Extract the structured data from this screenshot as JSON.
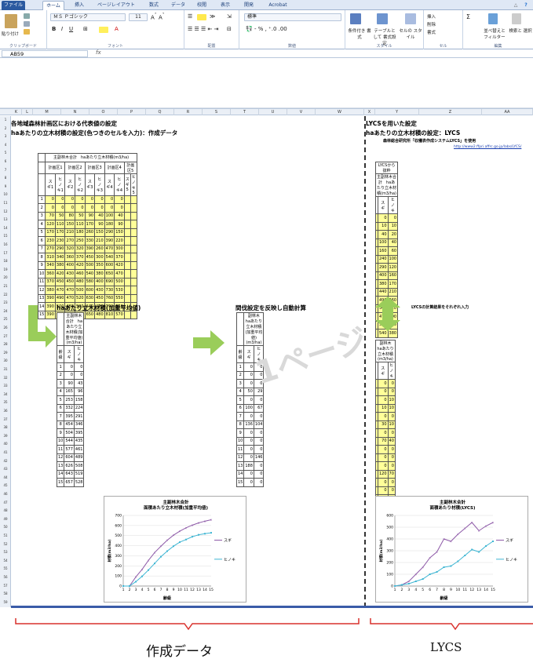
{
  "menubar": {
    "tabs": [
      "ファイル",
      "ホーム",
      "挿入",
      "ページレイアウト",
      "数式",
      "データ",
      "校閲",
      "表示",
      "開発",
      "Acrobat"
    ]
  },
  "ribbon": {
    "paste": "貼り付け",
    "clipboard": "クリップボード",
    "font_name": "ＭＳ Ｐゴシック",
    "font_size": "11",
    "font_group": "フォント",
    "align_group": "配置",
    "number_format": "標準",
    "number_group": "数値",
    "cond_format": "条件付き 書式",
    "table_format": "テーブルとして 書式設定",
    "cell_style": "セルの スタイル",
    "style_group": "スタイル",
    "insert": "挿入",
    "delete": "削除",
    "format": "書式",
    "cell_group": "セル",
    "sort": "並べ替えと フィルター",
    "find": "検索と 選択",
    "edit_group": "編集"
  },
  "formula": {
    "namebox": "AB59",
    "fx": "fx"
  },
  "columns": [
    "K",
    "L",
    "M",
    "N",
    "O",
    "P",
    "Q",
    "R",
    "S",
    "T",
    "U",
    "V",
    "W",
    "X",
    "Y",
    "Z",
    "AA"
  ],
  "titles": {
    "left1": "各地域森林計画区における代表値の設定",
    "left2": "haあたりの立木材積の設定(色つきのセルを入力)：作成データ",
    "right1": "LYCSを用いた設定",
    "right2": "haあたりの立木材積の設定：LYCS",
    "right3": "森林総合研究所「収穫表作成システムLYCS」を使用",
    "right_url": "http://www2.ffpri.affrc.go.jp/labs/LYCS/"
  },
  "table1": {
    "title": "主副林木合計　haあたり立木材積(m3/ha)",
    "groups": [
      "計画区1",
      "計画区2",
      "計画区3",
      "計画区4",
      "計画区5"
    ],
    "sub": [
      "スギ1",
      "ヒノキ1",
      "スギ2",
      "ヒノキ2",
      "スギ3",
      "ヒノキ3",
      "スギ4",
      "ヒノキ4",
      "スギ5",
      "ヒノキ5"
    ],
    "rows": [
      [
        "1",
        "0",
        "0",
        "0",
        "0",
        "0",
        "0",
        "0",
        "0",
        "",
        ""
      ],
      [
        "2",
        "0",
        "0",
        "0",
        "0",
        "0",
        "0",
        "0",
        "0",
        "",
        ""
      ],
      [
        "3",
        "70",
        "50",
        "80",
        "50",
        "90",
        "40",
        "100",
        "40",
        "",
        ""
      ],
      [
        "4",
        "120",
        "110",
        "150",
        "110",
        "170",
        "90",
        "180",
        "90",
        "",
        ""
      ],
      [
        "5",
        "170",
        "170",
        "210",
        "180",
        "260",
        "150",
        "290",
        "150",
        "",
        ""
      ],
      [
        "6",
        "230",
        "230",
        "270",
        "250",
        "330",
        "210",
        "390",
        "220",
        "",
        ""
      ],
      [
        "7",
        "270",
        "290",
        "320",
        "320",
        "390",
        "260",
        "470",
        "300",
        "",
        ""
      ],
      [
        "8",
        "310",
        "340",
        "360",
        "370",
        "450",
        "300",
        "540",
        "370",
        "",
        ""
      ],
      [
        "9",
        "340",
        "380",
        "400",
        "420",
        "500",
        "350",
        "600",
        "420",
        "",
        ""
      ],
      [
        "10",
        "360",
        "420",
        "430",
        "460",
        "540",
        "380",
        "650",
        "470",
        "",
        ""
      ],
      [
        "11",
        "370",
        "450",
        "450",
        "480",
        "580",
        "400",
        "690",
        "500",
        "",
        ""
      ],
      [
        "12",
        "380",
        "470",
        "470",
        "500",
        "600",
        "430",
        "730",
        "530",
        "",
        ""
      ],
      [
        "13",
        "390",
        "490",
        "470",
        "520",
        "630",
        "450",
        "760",
        "550",
        "",
        ""
      ],
      [
        "14",
        "390",
        "500",
        "480",
        "520",
        "640",
        "470",
        "790",
        "560",
        "",
        ""
      ],
      [
        "15",
        "390",
        "500",
        "480",
        "530",
        "650",
        "480",
        "810",
        "570",
        "",
        ""
      ]
    ]
  },
  "table2": {
    "section": "haあたり立木材積(加重平均値)",
    "title": "主副林木合計　haあたり立木材積(加重平均値)(m3/ha)",
    "head": [
      "齢級",
      "スギ",
      "ヒノキ"
    ],
    "rows": [
      [
        "1",
        "0",
        "0"
      ],
      [
        "2",
        "0",
        "0"
      ],
      [
        "3",
        "90",
        "43"
      ],
      [
        "4",
        "165",
        "96"
      ],
      [
        "5",
        "253",
        "158"
      ],
      [
        "6",
        "332",
        "224"
      ],
      [
        "7",
        "395",
        "291"
      ],
      [
        "8",
        "454",
        "346"
      ],
      [
        "9",
        "504",
        "395"
      ],
      [
        "10",
        "544",
        "435"
      ],
      [
        "11",
        "577",
        "461"
      ],
      [
        "12",
        "604",
        "489"
      ],
      [
        "13",
        "626",
        "508"
      ],
      [
        "14",
        "643",
        "519"
      ],
      [
        "15",
        "657",
        "528"
      ]
    ]
  },
  "table3": {
    "section": "間伐設定を反映し自動計算",
    "title": "副林木　haあたり立木材積(加重平均値)(m3/ha)",
    "head": [
      "齢級",
      "スギ",
      "ヒノキ"
    ],
    "rows": [
      [
        "1",
        "0",
        "0"
      ],
      [
        "2",
        "0",
        "0"
      ],
      [
        "3",
        "0",
        "0"
      ],
      [
        "4",
        "50",
        "29"
      ],
      [
        "5",
        "0",
        "0"
      ],
      [
        "6",
        "100",
        "67"
      ],
      [
        "7",
        "0",
        "0"
      ],
      [
        "8",
        "136",
        "104"
      ],
      [
        "9",
        "0",
        "0"
      ],
      [
        "10",
        "0",
        "0"
      ],
      [
        "11",
        "0",
        "0"
      ],
      [
        "12",
        "0",
        "146"
      ],
      [
        "13",
        "188",
        "0"
      ],
      [
        "14",
        "0",
        "0"
      ],
      [
        "15",
        "0",
        "0"
      ]
    ]
  },
  "table4": {
    "caption": "LYCSから抜粋",
    "title": "主副林木合計　haあたり立木材積(m3/ha)",
    "head": [
      "",
      "スギ",
      "ヒノキ"
    ],
    "rows": [
      [
        "",
        "0",
        "0"
      ],
      [
        "",
        "10",
        "10"
      ],
      [
        "",
        "40",
        "20"
      ],
      [
        "",
        "100",
        "40"
      ],
      [
        "",
        "160",
        "60"
      ],
      [
        "",
        "240",
        "100"
      ],
      [
        "",
        "290",
        "120"
      ],
      [
        "",
        "400",
        "160"
      ],
      [
        "",
        "380",
        "170"
      ],
      [
        "",
        "440",
        "210"
      ],
      [
        "",
        "490",
        "260"
      ],
      [
        "",
        "540",
        "310"
      ],
      [
        "",
        "470",
        "290"
      ],
      [
        "",
        "510",
        "340"
      ],
      [
        "",
        "540",
        "380"
      ]
    ]
  },
  "table5": {
    "note": "LYCSの計算結果をそれぞれ入力",
    "title": "副林木　haあたり立木材積(m3/ha)",
    "head": [
      "",
      "スギ",
      "ヒノキ"
    ],
    "rows": [
      [
        "",
        "0",
        "0"
      ],
      [
        "",
        "0",
        "0"
      ],
      [
        "",
        "0",
        "10"
      ],
      [
        "",
        "10",
        "10"
      ],
      [
        "",
        "0",
        "0"
      ],
      [
        "",
        "30",
        "10"
      ],
      [
        "",
        "0",
        "0"
      ],
      [
        "",
        "70",
        "40"
      ],
      [
        "",
        "0",
        "0"
      ],
      [
        "",
        "0",
        "0"
      ],
      [
        "",
        "0",
        "0"
      ],
      [
        "",
        "120",
        "70"
      ],
      [
        "",
        "0",
        "0"
      ],
      [
        "",
        "0",
        "0"
      ],
      [
        "",
        "0",
        "0"
      ]
    ]
  },
  "watermark": "1ページ",
  "chart_data": [
    {
      "type": "line",
      "title": "主副林木合計 面積あたり立木材積(加重平均値)",
      "xlabel": "齢級",
      "ylabel": "材積(m3/ha)",
      "ylim": [
        0,
        700
      ],
      "yticks": [
        0,
        100,
        200,
        300,
        400,
        500,
        600,
        700
      ],
      "categories": [
        "1",
        "2",
        "3",
        "4",
        "5",
        "6",
        "7",
        "8",
        "9",
        "10",
        "11",
        "12",
        "13",
        "14",
        "15"
      ],
      "series": [
        {
          "name": "スギ",
          "color": "#8e5aa8",
          "values": [
            0,
            0,
            90,
            165,
            253,
            332,
            395,
            454,
            504,
            544,
            577,
            604,
            626,
            643,
            657
          ]
        },
        {
          "name": "ヒノキ",
          "color": "#3fb6d3",
          "values": [
            0,
            0,
            43,
            96,
            158,
            224,
            291,
            346,
            395,
            435,
            461,
            489,
            508,
            519,
            528
          ]
        }
      ]
    },
    {
      "type": "line",
      "title": "主副林木合計 面積あたり材積(LYCS)",
      "xlabel": "齢級",
      "ylabel": "材積(m3/ha)",
      "ylim": [
        0,
        600
      ],
      "yticks": [
        0,
        100,
        200,
        300,
        400,
        500,
        600
      ],
      "categories": [
        "1",
        "2",
        "3",
        "4",
        "5",
        "6",
        "7",
        "8",
        "9",
        "10",
        "11",
        "12",
        "13",
        "14",
        "15"
      ],
      "series": [
        {
          "name": "スギ",
          "color": "#8e5aa8",
          "values": [
            0,
            10,
            40,
            100,
            160,
            240,
            290,
            400,
            380,
            440,
            490,
            540,
            470,
            510,
            540
          ]
        },
        {
          "name": "ヒノキ",
          "color": "#3fb6d3",
          "values": [
            0,
            10,
            20,
            40,
            60,
            100,
            120,
            160,
            170,
            210,
            260,
            310,
            290,
            340,
            380
          ]
        }
      ]
    }
  ],
  "captions": {
    "left": "作成データ",
    "right": "LYCS"
  },
  "colors": {
    "yellow": "#ffff99",
    "green": "#9acd5a",
    "red": "#d9302c",
    "gray_arrow": "#d9d9d9"
  }
}
